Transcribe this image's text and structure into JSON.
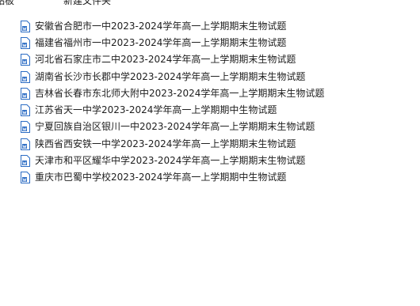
{
  "toolbar": {
    "left_label": "剪贴板",
    "new_folder_label": "新建文件夹"
  },
  "files": [
    {
      "name": "安徽省合肥市一中2023-2024学年高一上学期期末生物试题",
      "icon": "word-doc-icon"
    },
    {
      "name": "福建省福州市一中2023-2024学年高一上学期期末生物试题",
      "icon": "word-doc-icon"
    },
    {
      "name": "河北省石家庄市二中2023-2024学年高一上学期期末生物试题",
      "icon": "word-doc-icon"
    },
    {
      "name": "湖南省长沙市长郡中学2023-2024学年高一上学期期末生物试题",
      "icon": "word-doc-icon"
    },
    {
      "name": "吉林省长春市东北师大附中2023-2024学年高一上学期期末生物试题",
      "icon": "word-doc-icon"
    },
    {
      "name": "江苏省天一中学2023-2024学年高一上学期期中生物试题",
      "icon": "word-doc-icon"
    },
    {
      "name": "宁夏回族自治区银川一中2023-2024学年高一上学期期末生物试题",
      "icon": "word-doc-icon"
    },
    {
      "name": "陕西省西安铁一中学2023-2024学年高一上学期期末生物试题",
      "icon": "word-doc-icon"
    },
    {
      "name": "天津市和平区耀华中学2023-2024学年高一上学期期末生物试题",
      "icon": "word-doc-icon"
    },
    {
      "name": "重庆市巴蜀中学校2023-2024学年高一上学期期中生物试题",
      "icon": "word-doc-icon"
    }
  ],
  "colors": {
    "icon_blue": "#2b6cc4",
    "text": "#1e1e1e"
  }
}
